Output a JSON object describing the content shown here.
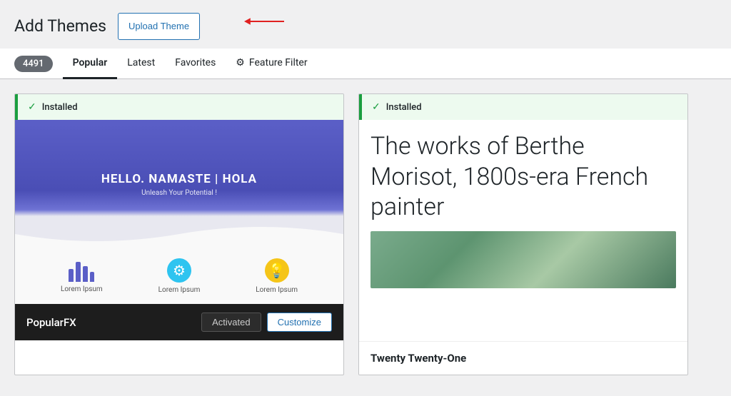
{
  "header": {
    "title": "Add Themes",
    "upload_button_label": "Upload Theme"
  },
  "tabs": {
    "count_badge": "4491",
    "items": [
      {
        "label": "Popular",
        "active": true
      },
      {
        "label": "Latest",
        "active": false
      },
      {
        "label": "Favorites",
        "active": false
      },
      {
        "label": "Feature Filter",
        "active": false
      }
    ]
  },
  "themes": [
    {
      "id": "popularfx",
      "installed": true,
      "installed_label": "Installed",
      "hero_title": "HELLO. NAMASTE | HOLA",
      "hero_subtitle": "Unleash Your Potential !",
      "icon_labels": [
        "Lorem Ipsum",
        "Lorem Ipsum",
        "Lorem Ipsum"
      ],
      "name": "PopularFX",
      "activated_label": "Activated",
      "customize_label": "Customize"
    },
    {
      "id": "twentytwentyone",
      "installed": true,
      "installed_label": "Installed",
      "preview_text": "The works of Berthe Morisot, 1800s-era French painter",
      "name": "Twenty Twenty-One"
    }
  ],
  "icons": {
    "check": "✓",
    "gear": "⚙",
    "bulb": "💡",
    "chart": "chart"
  },
  "colors": {
    "installed_bg": "#edfaef",
    "installed_border": "#1a9e3f",
    "installed_check": "#1a9e3f",
    "hero_bg": "#5b5fc7",
    "footer_bg": "#1d1d1d"
  }
}
